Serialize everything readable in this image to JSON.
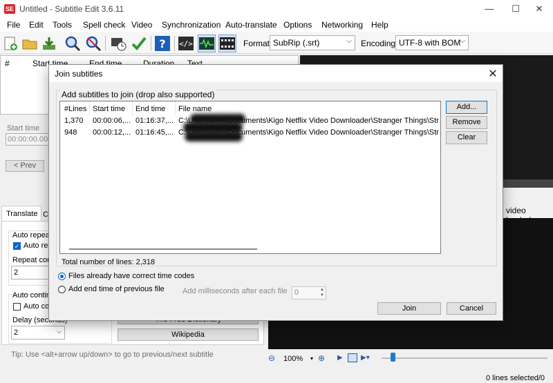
{
  "window": {
    "title": "Untitled - Subtitle Edit 3.6.11",
    "app_icon": "SE",
    "min": "—",
    "max": "☐",
    "close": "✕"
  },
  "menu": [
    "File",
    "Edit",
    "Tools",
    "Spell check",
    "Video",
    "Synchronization",
    "Auto-translate",
    "Options",
    "Networking",
    "Help"
  ],
  "toolbar": {
    "format_label": "Format",
    "format_value": "SubRip (.srt)",
    "encoding_label": "Encoding",
    "encoding_value": "UTF-8 with BOM"
  },
  "grid": {
    "headers": [
      "#",
      "Start time",
      "End time",
      "Duration",
      "Text"
    ]
  },
  "left_panel": {
    "start_time_label": "Start time",
    "start_time_value": "00:00:00.000",
    "prev_button": "< Prev",
    "tab_translate": "Translate",
    "tab_other": "Cr",
    "auto_repeat": "Auto repea",
    "auto_repeat_check": "Auto re",
    "repeat_count_label": "Repeat cou",
    "repeat_count_value": "2",
    "auto_continue": "Auto contin",
    "auto_continue_check": "Auto co",
    "delay_label": "Delay (seconds)",
    "delay_value": "2",
    "free_dictionary": "The Free Dictionary",
    "wikipedia": "Wikipedia",
    "tip": "Tip: Use <alt+arrow up/down> to go to previous/next subtitle"
  },
  "video": {
    "no_video": "video loaded",
    "zoom": "100%"
  },
  "status": {
    "lines_selected": "0 lines selected/0"
  },
  "dialog": {
    "title": "Join subtitles",
    "close": "✕",
    "group_title": "Add subtitles to join (drop also supported)",
    "columns": [
      "#Lines",
      "Start time",
      "End time",
      "File name"
    ],
    "rows": [
      {
        "lines": "1,370",
        "start": "00:00:06,...",
        "end": "01:16:37,...",
        "file": "C:\\Users\\wifm\\Documents\\Kigo Netflix Video Downloader\\Stranger Things\\Str"
      },
      {
        "lines": "948",
        "start": "00:00:12,...",
        "end": "01:16:45,...",
        "file": "C:\\Users\\wifm\\Documents\\Kigo Netflix Video Downloader\\Stranger Things\\Str"
      }
    ],
    "add_button": "Add...",
    "remove_button": "Remove",
    "clear_button": "Clear",
    "total_lines": "Total number of lines: 2,318",
    "radio_correct": "Files already have correct time codes",
    "radio_add_end": "Add end time of previous file",
    "ms_label": "Add milliseconds after each file",
    "ms_value": "0",
    "join_button": "Join",
    "cancel_button": "Cancel"
  }
}
